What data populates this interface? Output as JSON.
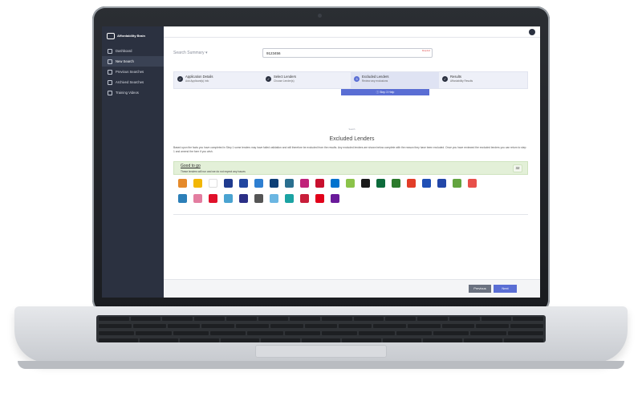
{
  "app": {
    "brand": "Affordability Brain"
  },
  "sidebar": {
    "items": [
      {
        "label": "Dashboard"
      },
      {
        "label": "New Search"
      },
      {
        "label": "Previous Searches"
      },
      {
        "label": "Archived Searches"
      },
      {
        "label": "Training Videos"
      }
    ]
  },
  "search": {
    "summary_label": "Search Summary ▾",
    "value": "9123456",
    "required": "Required"
  },
  "steps": [
    {
      "num": "✓",
      "title": "Application Details",
      "subtitle": "Add Applicant(s) info"
    },
    {
      "num": "✓",
      "title": "Select Lenders",
      "subtitle": "Choose Lender(s)"
    },
    {
      "num": "3",
      "title": "Excluded Lenders",
      "subtitle": "Review any exclusions"
    },
    {
      "num": "✓",
      "title": "Results",
      "subtitle": "Affordability Results"
    }
  ],
  "step_help": "ⓘ  Step 3 Help",
  "content": {
    "tiny": "Search",
    "heading": "Excluded Lenders",
    "description": "Based upon the facts you have completed in Step 1 some lenders may have failed validation and will therefore be excluded from the results. Any excluded lenders are shown below complete with the reason they have been excluded. Once you have reviewed the excluded lenders you can return to step 1 and amend the form if you wish.",
    "good_title": "Good to go",
    "good_sub": "These lenders will run and we do not expect any issues",
    "good_count": "32"
  },
  "lender_colors": {
    "row1": [
      "#e58a2b",
      "#f2b705",
      "#ffffff",
      "#1f3b8f",
      "#2146a0",
      "#2e7fd1",
      "#0d3f77",
      "#2a6f8f",
      "#c0237a",
      "#c8102e",
      "#0072ce",
      "#8bc34a",
      "#1a1a1a",
      "#0d6b3b",
      "#2b7a2b",
      "#e23d28",
      "#1f4fb5",
      "#2347a8",
      "#63a43f",
      "#e8504a"
    ],
    "row2": [
      "#2c7fb8",
      "#e37da0",
      "#e0112b",
      "#4aa3d1",
      "#2b2f86",
      "#555555",
      "#6bb6e2",
      "#1ba3a3",
      "#c81e3a",
      "#e1001a",
      "#6a1b9a"
    ]
  },
  "footer": {
    "previous": "Previous",
    "next": "Next"
  }
}
